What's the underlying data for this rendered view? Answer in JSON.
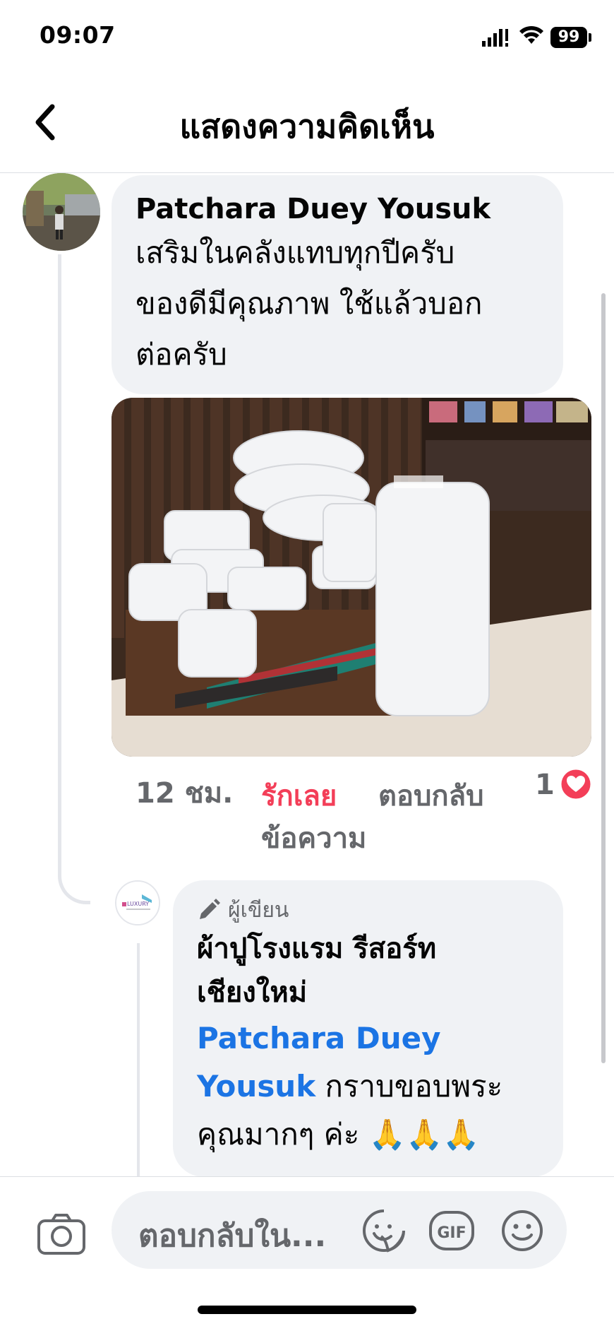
{
  "status_bar": {
    "time": "09:07",
    "battery": "99"
  },
  "header": {
    "title": "แสดงความคิดเห็น",
    "back_icon": "chevron-left-icon"
  },
  "comment": {
    "author": "Patchara Duey Yousuk",
    "text": "เสริมในคลังแทบทุกปีครับ\nของดีมีคุณภาพ ใช้แล้วบอก\nต่อครับ",
    "meta": {
      "time": "12 ชม.",
      "like": "รักเลย",
      "reply": "ตอบกลับ",
      "message": "ข้อความ",
      "reaction_count": "1"
    }
  },
  "reply": {
    "badge": "ผู้เขียน",
    "author": "ผ้าปูโรงแรม รีสอร์ท\nเชียงใหม่",
    "mention": "Patchara Duey\nYousuk",
    "text": " กราบขอบพระคุณมากๆ ค่ะ 🙏🙏🙏",
    "logo_text": "LUXURY"
  },
  "composer": {
    "placeholder": "ตอบกลับใน..."
  },
  "colors": {
    "like_active": "#f33e58",
    "mention": "#1b74e4",
    "bubble": "#f0f2f5"
  }
}
